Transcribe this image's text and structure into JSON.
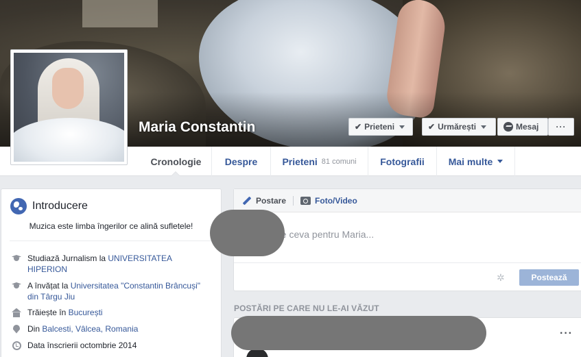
{
  "profile": {
    "name": "Maria Constantin"
  },
  "cover_actions": {
    "friends_label": "Prieteni",
    "follow_label": "Urmărești",
    "message_label": "Mesaj",
    "more_label": "···"
  },
  "tabs": [
    {
      "label": "Cronologie",
      "active": true
    },
    {
      "label": "Despre"
    },
    {
      "label": "Prieteni",
      "sub": "81 comuni"
    },
    {
      "label": "Fotografii"
    },
    {
      "label": "Mai multe"
    }
  ],
  "intro": {
    "title": "Introducere",
    "bio": "Muzica este limba îngerilor ce alină sufletele!",
    "rows": [
      {
        "icon": "graduation-cap-icon",
        "prefix": "Studiază Jurnalism la ",
        "link": "UNIVERSITATEA HIPERION",
        "suffix": ""
      },
      {
        "icon": "graduation-cap-icon",
        "prefix": "A învățat la ",
        "link": "Universitatea \"Constantin Brâncuși\" din Târgu Jiu",
        "suffix": ""
      },
      {
        "icon": "house-icon",
        "prefix": "Trăiește în ",
        "link": "București",
        "suffix": ""
      },
      {
        "icon": "location-pin-icon",
        "prefix": "Din ",
        "link": "Balcesti, Vâlcea, Romania",
        "suffix": ""
      },
      {
        "icon": "clock-icon",
        "prefix": "Data înscrierii octombrie 2014",
        "link": "",
        "suffix": ""
      }
    ]
  },
  "composer": {
    "tab_post": "Postare",
    "tab_photo": "Foto/Video",
    "placeholder": "Scrie ceva pentru Maria...",
    "visible_placeholder": "crie ceva pentru Maria...",
    "post_button": "Postează"
  },
  "feed": {
    "section_label": "POSTĂRI PE CARE NU LE-AI VĂZUT",
    "menu": "···"
  },
  "colors": {
    "link": "#365899",
    "brand": "#4267b2",
    "background": "#e9ebee",
    "disabled_button": "#9cb4d8"
  }
}
